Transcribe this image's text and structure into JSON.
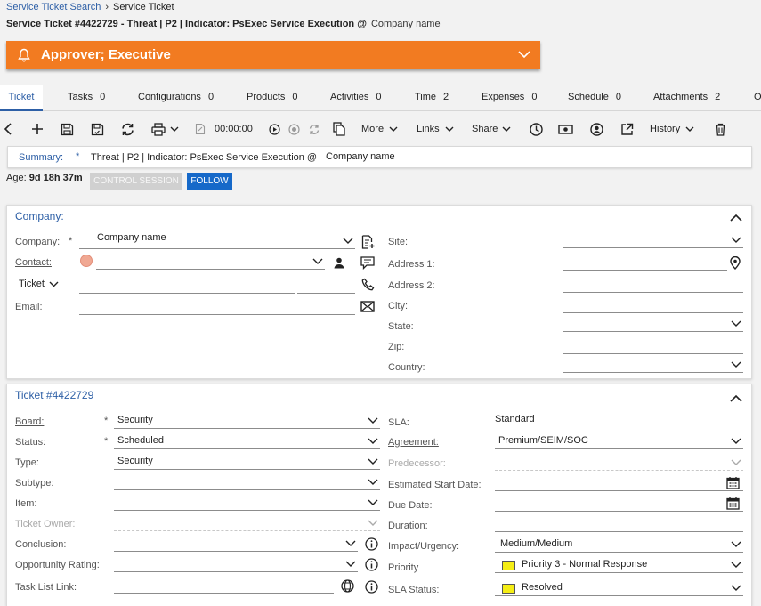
{
  "breadcrumb": {
    "parent": "Service Ticket Search",
    "current": "Service Ticket"
  },
  "ticket_title": {
    "main": "Service Ticket #4422729 - Threat | P2 | Indicator: PsExec Service Execution @",
    "company": "Company name"
  },
  "banner": {
    "text": "Approver; Executive",
    "color": "#f27b21"
  },
  "tabs": [
    {
      "label": "Ticket",
      "count": ""
    },
    {
      "label": "Tasks",
      "count": "0"
    },
    {
      "label": "Configurations",
      "count": "0"
    },
    {
      "label": "Products",
      "count": "0"
    },
    {
      "label": "Activities",
      "count": "0"
    },
    {
      "label": "Time",
      "count": "2"
    },
    {
      "label": "Expenses",
      "count": "0"
    },
    {
      "label": "Schedule",
      "count": "0"
    },
    {
      "label": "Attachments",
      "count": "2"
    },
    {
      "label": "O",
      "count": ""
    }
  ],
  "toolbar": {
    "timer": "00:00:00",
    "more": "More",
    "links": "Links",
    "share": "Share",
    "history": "History",
    "icons": [
      "back-icon",
      "add-icon",
      "save-icon",
      "save-close-icon",
      "refresh-icon",
      "print-icon",
      "note-icon",
      "play-icon",
      "stop-icon",
      "reset-icon",
      "copy-icon",
      "clock-icon",
      "money-icon",
      "user-circle-icon",
      "external-link-icon",
      "trash-icon"
    ]
  },
  "summary": {
    "label": "Summary:",
    "required": "*",
    "value": "Threat | P2 | Indicator: PsExec Service Execution @",
    "company": "Company name"
  },
  "age": {
    "label": "Age:",
    "value": "9d 18h 37m"
  },
  "buttons": {
    "control_session": "CONTROL SESSION",
    "follow": "FOLLOW"
  },
  "company_panel": {
    "title": "Company:",
    "company_label": "Company:",
    "company_value": "Company name",
    "contact_label": "Contact:",
    "ticket_label": "Ticket",
    "email_label": "Email:",
    "site_label": "Site:",
    "address1_label": "Address 1:",
    "address2_label": "Address 2:",
    "city_label": "City:",
    "state_label": "State:",
    "zip_label": "Zip:",
    "country_label": "Country:"
  },
  "ticket_panel": {
    "title": "Ticket #4422729",
    "board_label": "Board:",
    "board_value": "Security",
    "status_label": "Status:",
    "status_value": "Scheduled",
    "type_label": "Type:",
    "type_value": "Security",
    "subtype_label": "Subtype:",
    "item_label": "Item:",
    "owner_label": "Ticket Owner:",
    "conclusion_label": "Conclusion:",
    "opportunity_label": "Opportunity Rating:",
    "tasklist_label": "Task List Link:",
    "sla_label": "SLA:",
    "sla_value": "Standard",
    "agreement_label": "Agreement:",
    "agreement_value": "Premium/SEIM/SOC",
    "predecessor_label": "Predecessor:",
    "est_start_label": "Estimated Start Date:",
    "due_label": "Due Date:",
    "duration_label": "Duration:",
    "impact_label": "Impact/Urgency:",
    "impact_value": "Medium/Medium",
    "priority_label": "Priority",
    "priority_value": "Priority 3 - Normal Response",
    "priority_color": "#f5ee15",
    "sla_status_label": "SLA Status:",
    "sla_status_value": "Resolved",
    "sla_status_color": "#f5ee15"
  },
  "colors": {
    "accent": "#2d5fa6",
    "banner": "#f27b21",
    "follow": "#1669c9"
  }
}
